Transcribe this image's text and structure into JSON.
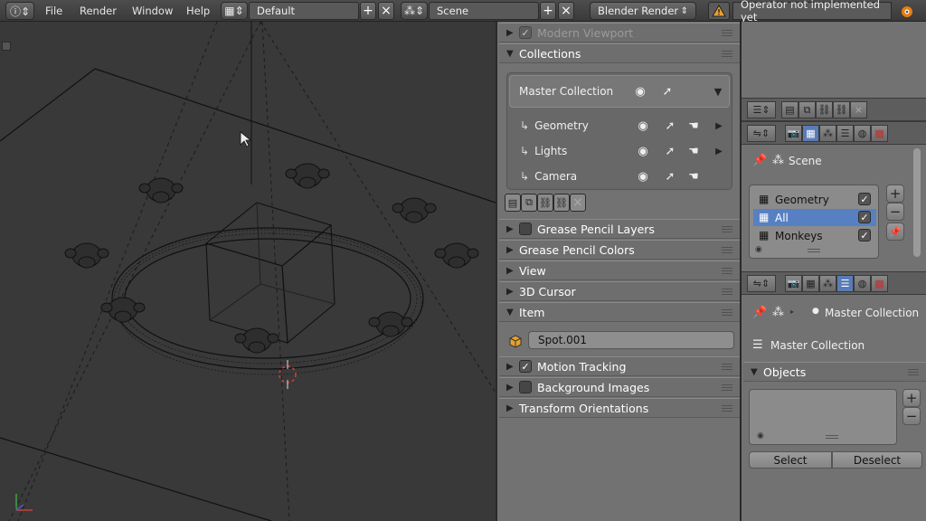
{
  "topbar": {
    "menus": [
      "File",
      "Render",
      "Window",
      "Help"
    ],
    "layout_value": "Default",
    "scene_value": "Scene",
    "render_engine": "Blender Render",
    "warning_text": "Operator not implemented yet"
  },
  "midpanel": {
    "modern_viewport": "Modern Viewport",
    "collections_title": "Collections",
    "master_collection": "Master Collection",
    "collections": [
      {
        "label": "Geometry",
        "has_arrow": true
      },
      {
        "label": "Lights",
        "has_arrow": true
      },
      {
        "label": "Camera",
        "has_arrow": false
      }
    ],
    "sections_a": [
      {
        "label": "Grease Pencil Layers",
        "checkbox": true
      },
      {
        "label": "Grease Pencil Colors",
        "checkbox": false
      },
      {
        "label": "View",
        "checkbox": false
      },
      {
        "label": "3D Cursor",
        "checkbox": false
      }
    ],
    "item_title": "Item",
    "item_name": "Spot.001",
    "sections_b": [
      {
        "label": "Motion Tracking",
        "checkbox": true,
        "checked": true
      },
      {
        "label": "Background Images",
        "checkbox": true,
        "checked": false
      },
      {
        "label": "Transform Orientations",
        "checkbox": false,
        "checked": false
      }
    ]
  },
  "rightpanel": {
    "scene_label": "Scene",
    "layers": [
      {
        "label": "Geometry",
        "selected": false
      },
      {
        "label": "All",
        "selected": true
      },
      {
        "label": "Monkeys",
        "selected": false
      }
    ],
    "breadcrumb_target": "Master Collection",
    "collection_label": "Master Collection",
    "objects_title": "Objects",
    "select_btn": "Select",
    "deselect_btn": "Deselect"
  },
  "colors": {
    "selection_blue": "#5680c2",
    "panel_bg": "#727272",
    "viewport_bg": "#393939"
  }
}
